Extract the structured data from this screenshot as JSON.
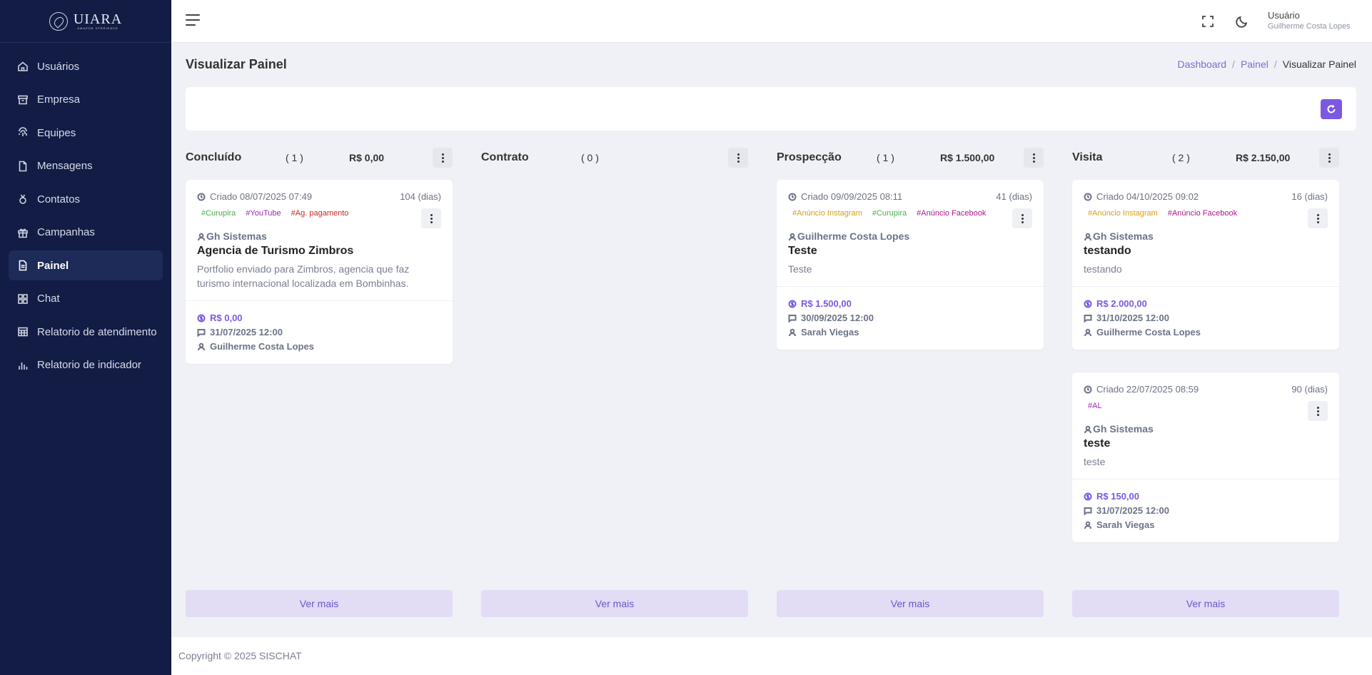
{
  "brand": {
    "name": "UIARA",
    "tagline": "AMAZON XPERIENCE"
  },
  "sidebar": {
    "items": [
      {
        "label": "Usuários",
        "icon": "home-icon",
        "active": false
      },
      {
        "label": "Empresa",
        "icon": "archive-icon",
        "active": false
      },
      {
        "label": "Equipes",
        "icon": "fingerprint-icon",
        "active": false
      },
      {
        "label": "Mensagens",
        "icon": "file-icon",
        "active": false
      },
      {
        "label": "Contatos",
        "icon": "medal-icon",
        "active": false
      },
      {
        "label": "Campanhas",
        "icon": "gift-icon",
        "active": false
      },
      {
        "label": "Painel",
        "icon": "file-text-icon",
        "active": true
      },
      {
        "label": "Chat",
        "icon": "grid-icon",
        "active": false
      },
      {
        "label": "Relatorio de atendimento",
        "icon": "table-icon",
        "active": false
      },
      {
        "label": "Relatorio de indicador",
        "icon": "bar-chart-icon",
        "active": false
      }
    ]
  },
  "topbar": {
    "user_label": "Usuário",
    "user_name": "Guilherme Costa Lopes"
  },
  "page": {
    "title": "Visualizar Painel",
    "breadcrumb": [
      "Dashboard",
      "Painel",
      "Visualizar Painel"
    ]
  },
  "columns": [
    {
      "title": "Concluído",
      "count": "( 1 )",
      "total": "R$ 0,00",
      "cards": [
        {
          "created": "Criado 08/07/2025 07:49",
          "days": "104 (dias)",
          "tags": [
            {
              "text": "#Curupira",
              "color": "#4caf50"
            },
            {
              "text": "#YouTube",
              "color": "#9c27b0"
            },
            {
              "text": "#Ag. pagamento",
              "color": "#c62828"
            }
          ],
          "company": "Gh Sistemas",
          "title": "Agencia de Turismo Zimbros",
          "desc": "Portfolio enviado para Zimbros, agencia que faz turismo internacional localizada em Bombinhas.",
          "value": "R$ 0,00",
          "date": "31/07/2025 12:00",
          "owner": "Guilherme Costa Lopes"
        }
      ]
    },
    {
      "title": "Contrato",
      "count": "( 0 )",
      "total": "",
      "cards": []
    },
    {
      "title": "Prospecção",
      "count": "( 1 )",
      "total": "R$ 1.500,00",
      "cards": [
        {
          "created": "Criado 09/09/2025 08:11",
          "days": "41 (dias)",
          "tags": [
            {
              "text": "#Anúncio Instagram",
              "color": "#d4a017"
            },
            {
              "text": "#Curupira",
              "color": "#4caf50"
            },
            {
              "text": "#Anúncio Facebook",
              "color": "#b0168f"
            }
          ],
          "company": "Guilherme Costa Lopes",
          "title": "Teste",
          "desc": "Teste",
          "value": "R$ 1.500,00",
          "date": "30/09/2025 12:00",
          "owner": "Sarah Viegas"
        }
      ]
    },
    {
      "title": "Visita",
      "count": "( 2 )",
      "total": "R$ 2.150,00",
      "cards": [
        {
          "created": "Criado 04/10/2025 09:02",
          "days": "16 (dias)",
          "tags": [
            {
              "text": "#Anúncio Instagram",
              "color": "#d4a017"
            },
            {
              "text": "#Anúncio Facebook",
              "color": "#b0168f"
            }
          ],
          "company": "Gh Sistemas",
          "title": "testando",
          "desc": "testando",
          "value": "R$ 2.000,00",
          "date": "31/10/2025 12:00",
          "owner": "Guilherme Costa Lopes"
        },
        {
          "created": "Criado 22/07/2025 08:59",
          "days": "90 (dias)",
          "tags": [
            {
              "text": "#AL",
              "color": "#9c27b0"
            }
          ],
          "company": "Gh Sistemas",
          "title": "teste",
          "desc": "teste",
          "value": "R$ 150,00",
          "date": "31/07/2025 12:00",
          "owner": "Sarah Viegas"
        }
      ]
    }
  ],
  "ver_mais_label": "Ver mais",
  "footer": {
    "copyright": "Copyright © 2025 SISCHAT"
  },
  "colors": {
    "sidebar_bg": "#121c45",
    "accent": "#7b59e0",
    "page_bg": "#f0f1f6"
  }
}
